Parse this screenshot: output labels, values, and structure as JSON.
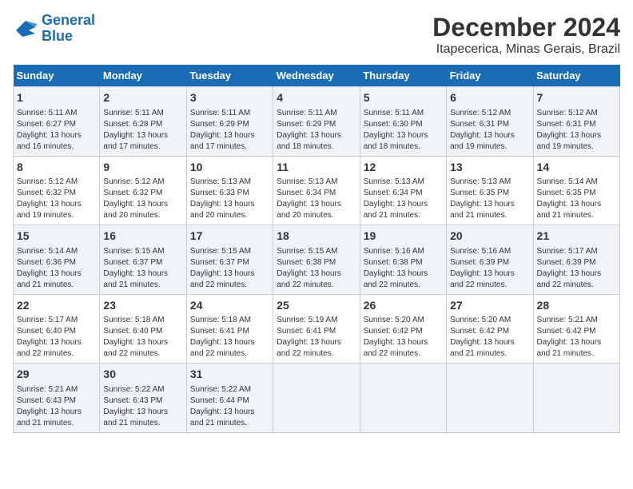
{
  "logo": {
    "line1": "General",
    "line2": "Blue"
  },
  "title": "December 2024",
  "subtitle": "Itapecerica, Minas Gerais, Brazil",
  "days_of_week": [
    "Sunday",
    "Monday",
    "Tuesday",
    "Wednesday",
    "Thursday",
    "Friday",
    "Saturday"
  ],
  "weeks": [
    [
      {
        "day": 1,
        "info": "Sunrise: 5:11 AM\nSunset: 6:27 PM\nDaylight: 13 hours\nand 16 minutes."
      },
      {
        "day": 2,
        "info": "Sunrise: 5:11 AM\nSunset: 6:28 PM\nDaylight: 13 hours\nand 17 minutes."
      },
      {
        "day": 3,
        "info": "Sunrise: 5:11 AM\nSunset: 6:29 PM\nDaylight: 13 hours\nand 17 minutes."
      },
      {
        "day": 4,
        "info": "Sunrise: 5:11 AM\nSunset: 6:29 PM\nDaylight: 13 hours\nand 18 minutes."
      },
      {
        "day": 5,
        "info": "Sunrise: 5:11 AM\nSunset: 6:30 PM\nDaylight: 13 hours\nand 18 minutes."
      },
      {
        "day": 6,
        "info": "Sunrise: 5:12 AM\nSunset: 6:31 PM\nDaylight: 13 hours\nand 19 minutes."
      },
      {
        "day": 7,
        "info": "Sunrise: 5:12 AM\nSunset: 6:31 PM\nDaylight: 13 hours\nand 19 minutes."
      }
    ],
    [
      {
        "day": 8,
        "info": "Sunrise: 5:12 AM\nSunset: 6:32 PM\nDaylight: 13 hours\nand 19 minutes."
      },
      {
        "day": 9,
        "info": "Sunrise: 5:12 AM\nSunset: 6:32 PM\nDaylight: 13 hours\nand 20 minutes."
      },
      {
        "day": 10,
        "info": "Sunrise: 5:13 AM\nSunset: 6:33 PM\nDaylight: 13 hours\nand 20 minutes."
      },
      {
        "day": 11,
        "info": "Sunrise: 5:13 AM\nSunset: 6:34 PM\nDaylight: 13 hours\nand 20 minutes."
      },
      {
        "day": 12,
        "info": "Sunrise: 5:13 AM\nSunset: 6:34 PM\nDaylight: 13 hours\nand 21 minutes."
      },
      {
        "day": 13,
        "info": "Sunrise: 5:13 AM\nSunset: 6:35 PM\nDaylight: 13 hours\nand 21 minutes."
      },
      {
        "day": 14,
        "info": "Sunrise: 5:14 AM\nSunset: 6:35 PM\nDaylight: 13 hours\nand 21 minutes."
      }
    ],
    [
      {
        "day": 15,
        "info": "Sunrise: 5:14 AM\nSunset: 6:36 PM\nDaylight: 13 hours\nand 21 minutes."
      },
      {
        "day": 16,
        "info": "Sunrise: 5:15 AM\nSunset: 6:37 PM\nDaylight: 13 hours\nand 21 minutes."
      },
      {
        "day": 17,
        "info": "Sunrise: 5:15 AM\nSunset: 6:37 PM\nDaylight: 13 hours\nand 22 minutes."
      },
      {
        "day": 18,
        "info": "Sunrise: 5:15 AM\nSunset: 6:38 PM\nDaylight: 13 hours\nand 22 minutes."
      },
      {
        "day": 19,
        "info": "Sunrise: 5:16 AM\nSunset: 6:38 PM\nDaylight: 13 hours\nand 22 minutes."
      },
      {
        "day": 20,
        "info": "Sunrise: 5:16 AM\nSunset: 6:39 PM\nDaylight: 13 hours\nand 22 minutes."
      },
      {
        "day": 21,
        "info": "Sunrise: 5:17 AM\nSunset: 6:39 PM\nDaylight: 13 hours\nand 22 minutes."
      }
    ],
    [
      {
        "day": 22,
        "info": "Sunrise: 5:17 AM\nSunset: 6:40 PM\nDaylight: 13 hours\nand 22 minutes."
      },
      {
        "day": 23,
        "info": "Sunrise: 5:18 AM\nSunset: 6:40 PM\nDaylight: 13 hours\nand 22 minutes."
      },
      {
        "day": 24,
        "info": "Sunrise: 5:18 AM\nSunset: 6:41 PM\nDaylight: 13 hours\nand 22 minutes."
      },
      {
        "day": 25,
        "info": "Sunrise: 5:19 AM\nSunset: 6:41 PM\nDaylight: 13 hours\nand 22 minutes."
      },
      {
        "day": 26,
        "info": "Sunrise: 5:20 AM\nSunset: 6:42 PM\nDaylight: 13 hours\nand 22 minutes."
      },
      {
        "day": 27,
        "info": "Sunrise: 5:20 AM\nSunset: 6:42 PM\nDaylight: 13 hours\nand 21 minutes."
      },
      {
        "day": 28,
        "info": "Sunrise: 5:21 AM\nSunset: 6:42 PM\nDaylight: 13 hours\nand 21 minutes."
      }
    ],
    [
      {
        "day": 29,
        "info": "Sunrise: 5:21 AM\nSunset: 6:43 PM\nDaylight: 13 hours\nand 21 minutes."
      },
      {
        "day": 30,
        "info": "Sunrise: 5:22 AM\nSunset: 6:43 PM\nDaylight: 13 hours\nand 21 minutes."
      },
      {
        "day": 31,
        "info": "Sunrise: 5:22 AM\nSunset: 6:44 PM\nDaylight: 13 hours\nand 21 minutes."
      },
      null,
      null,
      null,
      null
    ]
  ]
}
